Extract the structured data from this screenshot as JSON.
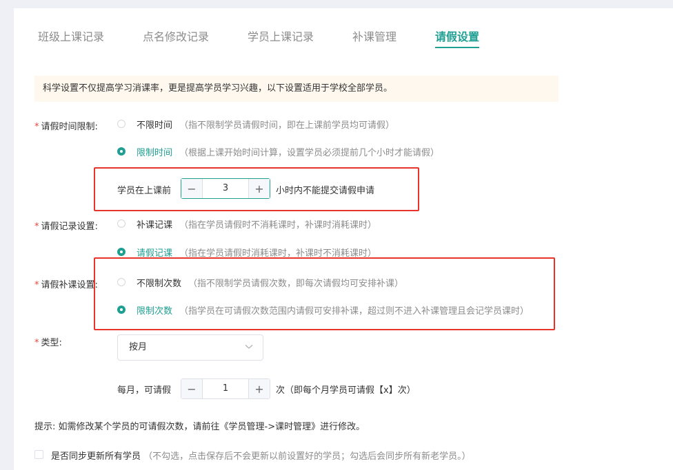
{
  "tabs": [
    {
      "label": "班级上课记录"
    },
    {
      "label": "点名修改记录"
    },
    {
      "label": "学员上课记录"
    },
    {
      "label": "补课管理"
    },
    {
      "label": "请假设置"
    }
  ],
  "active_tab_index": 4,
  "notice": "科学设置不仅提高学习消课率，更是提高学员学习兴趣，以下设置适用于学校全部学员。",
  "required_mark": "*",
  "leave_time_limit": {
    "label": "请假时间限制:",
    "options": [
      {
        "label": "不限时间",
        "desc": "（指不限制学员请假时间，即在上课前学员均可请假）",
        "selected": false
      },
      {
        "label": "限制时间",
        "desc": "（根据上课开始时间计算，设置学员必须提前几个小时才能请假）",
        "selected": true
      }
    ],
    "before_text": "学员在上课前",
    "hours_value": "3",
    "after_text": "小时内不能提交请假申请"
  },
  "leave_record": {
    "label": "请假记录设置:",
    "options": [
      {
        "label": "补课记课",
        "desc": "（指在学员请假时不消耗课时，补课时消耗课时）",
        "selected": false
      },
      {
        "label": "请假记课",
        "desc": "（指在学员请假时消耗课时，补课时不消耗课时）",
        "selected": true
      }
    ]
  },
  "leave_makeup": {
    "label": "请假补课设置:",
    "options": [
      {
        "label": "不限制次数",
        "desc": "（指不限制学员请假次数，即每次请假均可安排补课）",
        "selected": false
      },
      {
        "label": "限制次数",
        "desc": "（指学员在可请假次数范围内请假可安排补课，超过则不进入补课管理且会记学员课时）",
        "selected": true
      }
    ]
  },
  "type": {
    "label": "类型:",
    "value": "按月"
  },
  "monthly": {
    "before_text": "每月，可请假",
    "count_value": "1",
    "after_text": "次（即每个月学员可请假【x】次）"
  },
  "tip": "提示:  如需修改某个学员的可请假次数，请前往《学员管理->课时管理》进行修改。",
  "sync": {
    "label": "是否同步更新所有学员",
    "desc": "（不勾选，点击保存后不会更新以前设置好的学员；勾选后会同步所有新老学员。）",
    "checked": false
  },
  "stepper": {
    "minus": "−",
    "plus": "+"
  },
  "colors": {
    "accent": "#1f9e92",
    "highlight_box": "#e8332a",
    "notice_bg": "#fff8ef"
  }
}
